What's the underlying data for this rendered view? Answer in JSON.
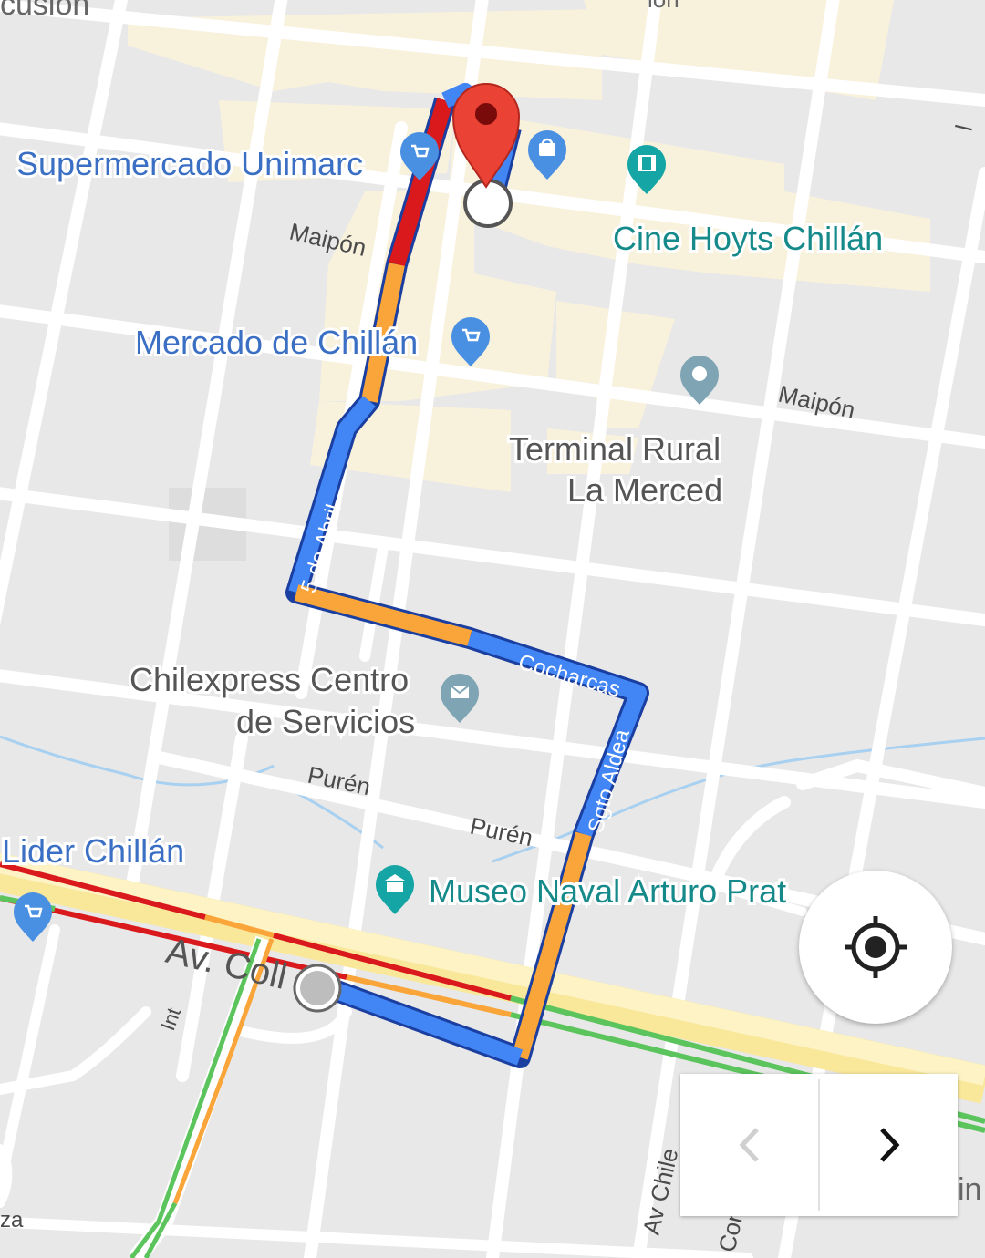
{
  "map": {
    "streets": {
      "maipon_upper": "Maipón",
      "maipon_lower": "Maipón",
      "cinco_de_abril": "5 de Abril",
      "cocharcas": "Cocharcas",
      "sgto_aldea": "Sgto Aldea",
      "puren_left": "Purén",
      "puren_right": "Purén",
      "av_collin": "Av. Coll",
      "int": "Int",
      "av_chile": "Av Chile",
      "cor": "Cor",
      "top_left_partial": "cusion",
      "top_center_partial": "ion",
      "bottom_left_partial": "za",
      "right_edge_partial_top": "l",
      "right_edge_partial_bottom": "in"
    },
    "places": {
      "supermercado": "Supermercado Unimarc",
      "cine": "Cine Hoyts Chillán",
      "mercado": "Mercado de Chillán",
      "terminal_line1": "Terminal Rural",
      "terminal_line2": "La Merced",
      "chilexpress_line1": "Chilexpress Centro",
      "chilexpress_line2": "de Servicios",
      "lider": "Lider Chillán",
      "museo": "Museo Naval Arturo Prat"
    },
    "icons": {
      "shopping_cart": "shopping-cart-icon",
      "shopping_bag": "shopping-bag-icon",
      "cinema": "cinema-icon",
      "generic_pin": "place-pin-icon",
      "mail": "mail-icon",
      "museum": "museum-icon",
      "destination": "destination-marker-icon",
      "origin": "origin-dot-icon",
      "locate": "my-location-icon",
      "prev": "chevron-left-icon",
      "next": "chevron-right-icon"
    },
    "colors": {
      "route_blue": "#4285f4",
      "traffic_orange": "#f9a53a",
      "traffic_red": "#d9191c",
      "traffic_green": "#5cc45c",
      "poi_blue": "#4a90e2",
      "poi_teal": "#16a5a5",
      "poi_gray": "#7fa4b3",
      "marker_red": "#ea4335"
    }
  },
  "controls": {
    "prev_disabled": true
  }
}
